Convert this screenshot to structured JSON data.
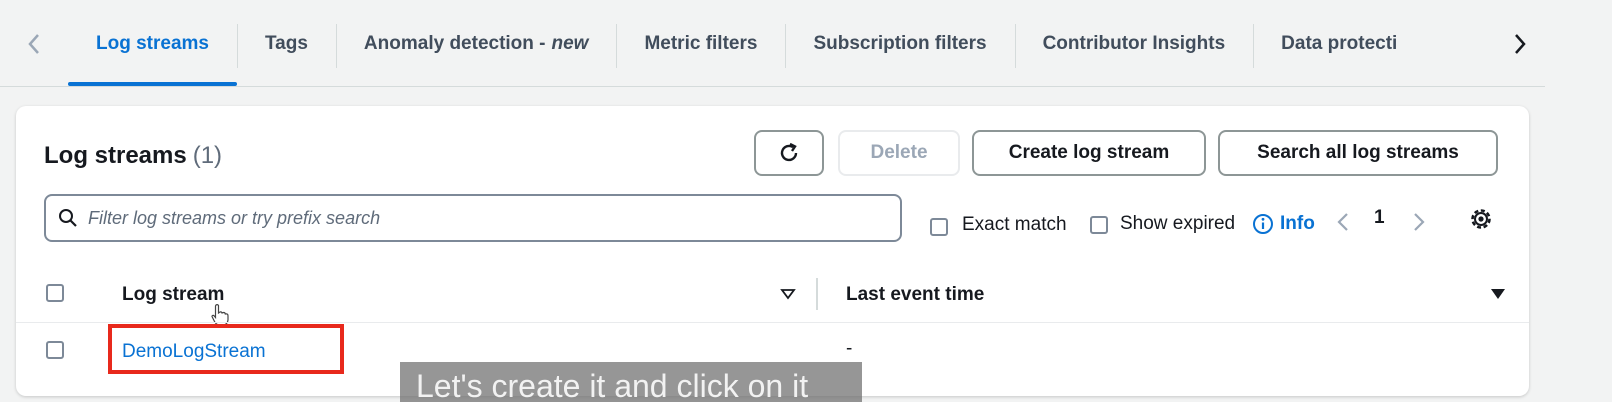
{
  "tabs": [
    {
      "label": "Log streams",
      "active": true
    },
    {
      "label": "Tags"
    },
    {
      "label": "Anomaly detection -",
      "suffix": "new"
    },
    {
      "label": "Metric filters"
    },
    {
      "label": "Subscription filters"
    },
    {
      "label": "Contributor Insights"
    },
    {
      "label": "Data protecti"
    }
  ],
  "panel": {
    "title": "Log streams",
    "count": "(1)",
    "buttons": {
      "refresh_icon": "refresh-icon",
      "delete": "Delete",
      "create": "Create log stream",
      "search_all": "Search all log streams"
    },
    "filter": {
      "placeholder": "Filter log streams or try prefix search"
    },
    "options": {
      "exact_match": "Exact match",
      "show_expired": "Show expired",
      "info": "Info"
    },
    "pagination": {
      "page": "1"
    }
  },
  "table": {
    "columns": [
      "Log stream",
      "Last event time"
    ],
    "rows": [
      {
        "log_stream": "DemoLogStream",
        "last_event_time": "-"
      }
    ]
  },
  "caption": "Let's create it and click on it",
  "colors": {
    "accent": "#0972d3",
    "highlight": "#e8291c"
  }
}
